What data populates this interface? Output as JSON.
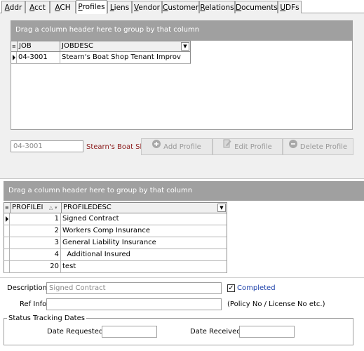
{
  "tabs": [
    {
      "label": "Addr",
      "ul": "A",
      "rest": "ddr"
    },
    {
      "label": "Acct",
      "ul": "A",
      "rest": "cct"
    },
    {
      "label": "ACH",
      "ul": "A",
      "rest": "CH"
    },
    {
      "label": "Profiles",
      "ul": "P",
      "rest": "rofiles"
    },
    {
      "label": "Liens",
      "ul": "L",
      "rest": "iens"
    },
    {
      "label": "Vendor",
      "ul": "V",
      "rest": "endor"
    },
    {
      "label": "Customer",
      "ul": "C",
      "rest": "ustomer"
    },
    {
      "label": "Relations",
      "ul": "R",
      "rest": "elations"
    },
    {
      "label": "Documents",
      "ul": "D",
      "rest": "ocuments"
    },
    {
      "label": "UDFs",
      "ul": "U",
      "rest": "DFs"
    }
  ],
  "jobs_grid": {
    "group_hint": "Drag a column header here to group by that column",
    "columns": [
      "JOB",
      "JOBDESC"
    ],
    "rows": [
      {
        "job": "04-3001",
        "desc": "Stearn's Boat Shop Tenant Improv"
      }
    ]
  },
  "job_field": {
    "value": "04-3001",
    "desc": "Stearn's Boat Sho"
  },
  "buttons": {
    "add_profile": "Add Profile",
    "edit_profile": "Edit Profile",
    "delete_profile": "Delete Profile"
  },
  "profiles_grid": {
    "group_hint": "Drag a column header here to group by that column",
    "columns": [
      "PROFILEI",
      "PROFILEDESC"
    ],
    "rows": [
      {
        "id": "1",
        "desc": "Signed Contract"
      },
      {
        "id": "2",
        "desc": "Workers Comp Insurance"
      },
      {
        "id": "3",
        "desc": "General Liability Insurance"
      },
      {
        "id": "4",
        "desc": "  Additional Insured"
      },
      {
        "id": "20",
        "desc": "test"
      }
    ]
  },
  "form": {
    "description_label": "Description:",
    "description_placeholder": "Signed Contract",
    "completed_label": "Completed",
    "completed_checked": true,
    "refinfo_label": "Ref Info:",
    "refinfo_hint": "(Policy No / License No etc.)",
    "status_group": "Status Tracking Dates",
    "date_requested_label": "Date Requested:",
    "date_received_label": "Date Received:"
  },
  "colors": {
    "accent_text": "#8b1a1a",
    "completed_text": "#1a3ea8",
    "group_bar": "#a0a0a0"
  }
}
